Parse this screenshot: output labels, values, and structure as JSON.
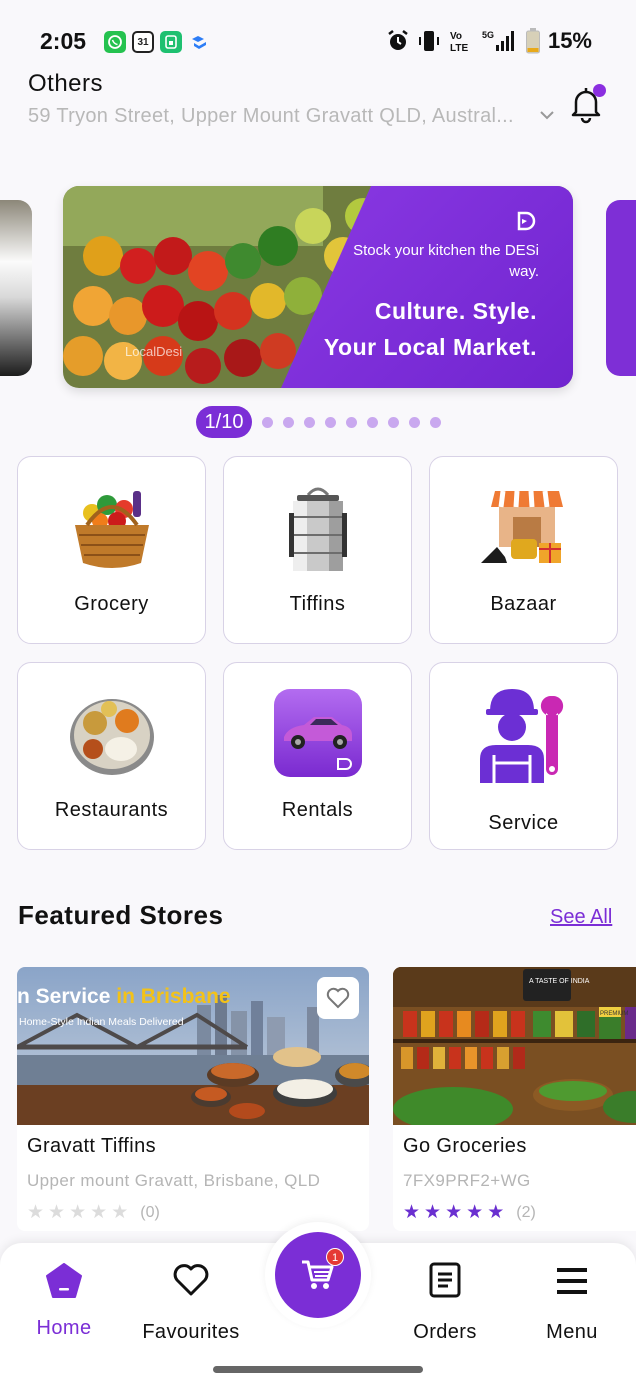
{
  "status_bar": {
    "time": "2:05",
    "battery": "15%",
    "calendar_day": "31",
    "icons": [
      "whatsapp-icon",
      "calendar-icon",
      "sim-icon",
      "dropbox-icon",
      "alarm-icon",
      "vibrate-icon",
      "volte-icon",
      "5g-signal-icon",
      "battery-icon"
    ]
  },
  "location": {
    "title": "Others",
    "address": "59 Tryon Street, Upper Mount Gravatt QLD, Austral..."
  },
  "banner": {
    "subtitle": "Stock your kitchen the DESi way.",
    "headline_1": "Culture. Style.",
    "headline_2": "Your Local Market.",
    "watermark": "LocalDesi",
    "page_indicator": "1/10",
    "page_count": 10,
    "current_page": 1
  },
  "categories": [
    {
      "label": "Grocery",
      "icon": "grocery-basket-icon"
    },
    {
      "label": "Tiffins",
      "icon": "tiffin-icon"
    },
    {
      "label": "Bazaar",
      "icon": "bazaar-icon"
    },
    {
      "label": "Restaurants",
      "icon": "thali-icon"
    },
    {
      "label": "Rentals",
      "icon": "car-icon"
    },
    {
      "label": "Service",
      "icon": "service-worker-icon"
    }
  ],
  "featured": {
    "title": "Featured Stores",
    "see_all": "See All",
    "stores": [
      {
        "name": "Gravatt Tiffins",
        "address": "Upper mount Gravatt, Brisbane, QLD",
        "rating": 0,
        "rating_count": "(0)",
        "banner_title_1": "n Service ",
        "banner_title_2": "in Brisbane",
        "banner_subtitle": "Home-Style Indian Meals Delivered"
      },
      {
        "name": "Go Groceries",
        "address": "7FX9PRF2+WG",
        "rating": 5,
        "rating_count": "(2)",
        "sign_text": "A TASTE OF INDIA",
        "product_label": "PREMIUM"
      }
    ]
  },
  "bottom_nav": {
    "items": [
      {
        "label": "Home",
        "active": true
      },
      {
        "label": "Favourites",
        "active": false
      },
      {
        "label": "Orders",
        "active": false
      },
      {
        "label": "Menu",
        "active": false
      }
    ],
    "cart_badge": "1"
  },
  "colors": {
    "accent": "#7b2ed6",
    "text": "#111111",
    "muted": "#b5b5b5",
    "star_filled": "#6a2fd0",
    "star_empty": "#dcdcdc"
  }
}
